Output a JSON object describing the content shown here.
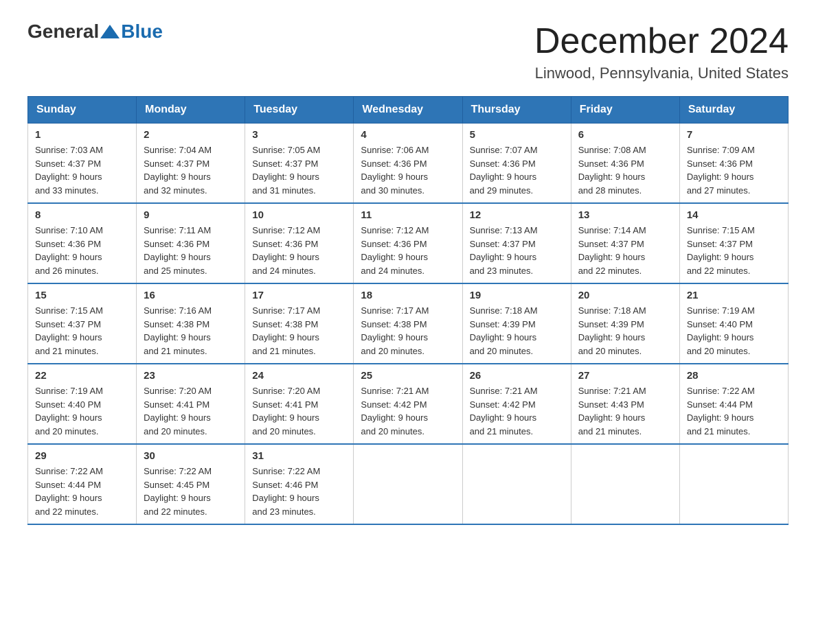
{
  "logo": {
    "text_general": "General",
    "text_blue": "Blue"
  },
  "header": {
    "title": "December 2024",
    "subtitle": "Linwood, Pennsylvania, United States"
  },
  "weekdays": [
    "Sunday",
    "Monday",
    "Tuesday",
    "Wednesday",
    "Thursday",
    "Friday",
    "Saturday"
  ],
  "weeks": [
    [
      {
        "day": "1",
        "sunrise": "7:03 AM",
        "sunset": "4:37 PM",
        "daylight": "9 hours and 33 minutes."
      },
      {
        "day": "2",
        "sunrise": "7:04 AM",
        "sunset": "4:37 PM",
        "daylight": "9 hours and 32 minutes."
      },
      {
        "day": "3",
        "sunrise": "7:05 AM",
        "sunset": "4:37 PM",
        "daylight": "9 hours and 31 minutes."
      },
      {
        "day": "4",
        "sunrise": "7:06 AM",
        "sunset": "4:36 PM",
        "daylight": "9 hours and 30 minutes."
      },
      {
        "day": "5",
        "sunrise": "7:07 AM",
        "sunset": "4:36 PM",
        "daylight": "9 hours and 29 minutes."
      },
      {
        "day": "6",
        "sunrise": "7:08 AM",
        "sunset": "4:36 PM",
        "daylight": "9 hours and 28 minutes."
      },
      {
        "day": "7",
        "sunrise": "7:09 AM",
        "sunset": "4:36 PM",
        "daylight": "9 hours and 27 minutes."
      }
    ],
    [
      {
        "day": "8",
        "sunrise": "7:10 AM",
        "sunset": "4:36 PM",
        "daylight": "9 hours and 26 minutes."
      },
      {
        "day": "9",
        "sunrise": "7:11 AM",
        "sunset": "4:36 PM",
        "daylight": "9 hours and 25 minutes."
      },
      {
        "day": "10",
        "sunrise": "7:12 AM",
        "sunset": "4:36 PM",
        "daylight": "9 hours and 24 minutes."
      },
      {
        "day": "11",
        "sunrise": "7:12 AM",
        "sunset": "4:36 PM",
        "daylight": "9 hours and 24 minutes."
      },
      {
        "day": "12",
        "sunrise": "7:13 AM",
        "sunset": "4:37 PM",
        "daylight": "9 hours and 23 minutes."
      },
      {
        "day": "13",
        "sunrise": "7:14 AM",
        "sunset": "4:37 PM",
        "daylight": "9 hours and 22 minutes."
      },
      {
        "day": "14",
        "sunrise": "7:15 AM",
        "sunset": "4:37 PM",
        "daylight": "9 hours and 22 minutes."
      }
    ],
    [
      {
        "day": "15",
        "sunrise": "7:15 AM",
        "sunset": "4:37 PM",
        "daylight": "9 hours and 21 minutes."
      },
      {
        "day": "16",
        "sunrise": "7:16 AM",
        "sunset": "4:38 PM",
        "daylight": "9 hours and 21 minutes."
      },
      {
        "day": "17",
        "sunrise": "7:17 AM",
        "sunset": "4:38 PM",
        "daylight": "9 hours and 21 minutes."
      },
      {
        "day": "18",
        "sunrise": "7:17 AM",
        "sunset": "4:38 PM",
        "daylight": "9 hours and 20 minutes."
      },
      {
        "day": "19",
        "sunrise": "7:18 AM",
        "sunset": "4:39 PM",
        "daylight": "9 hours and 20 minutes."
      },
      {
        "day": "20",
        "sunrise": "7:18 AM",
        "sunset": "4:39 PM",
        "daylight": "9 hours and 20 minutes."
      },
      {
        "day": "21",
        "sunrise": "7:19 AM",
        "sunset": "4:40 PM",
        "daylight": "9 hours and 20 minutes."
      }
    ],
    [
      {
        "day": "22",
        "sunrise": "7:19 AM",
        "sunset": "4:40 PM",
        "daylight": "9 hours and 20 minutes."
      },
      {
        "day": "23",
        "sunrise": "7:20 AM",
        "sunset": "4:41 PM",
        "daylight": "9 hours and 20 minutes."
      },
      {
        "day": "24",
        "sunrise": "7:20 AM",
        "sunset": "4:41 PM",
        "daylight": "9 hours and 20 minutes."
      },
      {
        "day": "25",
        "sunrise": "7:21 AM",
        "sunset": "4:42 PM",
        "daylight": "9 hours and 20 minutes."
      },
      {
        "day": "26",
        "sunrise": "7:21 AM",
        "sunset": "4:42 PM",
        "daylight": "9 hours and 21 minutes."
      },
      {
        "day": "27",
        "sunrise": "7:21 AM",
        "sunset": "4:43 PM",
        "daylight": "9 hours and 21 minutes."
      },
      {
        "day": "28",
        "sunrise": "7:22 AM",
        "sunset": "4:44 PM",
        "daylight": "9 hours and 21 minutes."
      }
    ],
    [
      {
        "day": "29",
        "sunrise": "7:22 AM",
        "sunset": "4:44 PM",
        "daylight": "9 hours and 22 minutes."
      },
      {
        "day": "30",
        "sunrise": "7:22 AM",
        "sunset": "4:45 PM",
        "daylight": "9 hours and 22 minutes."
      },
      {
        "day": "31",
        "sunrise": "7:22 AM",
        "sunset": "4:46 PM",
        "daylight": "9 hours and 23 minutes."
      },
      null,
      null,
      null,
      null
    ]
  ]
}
